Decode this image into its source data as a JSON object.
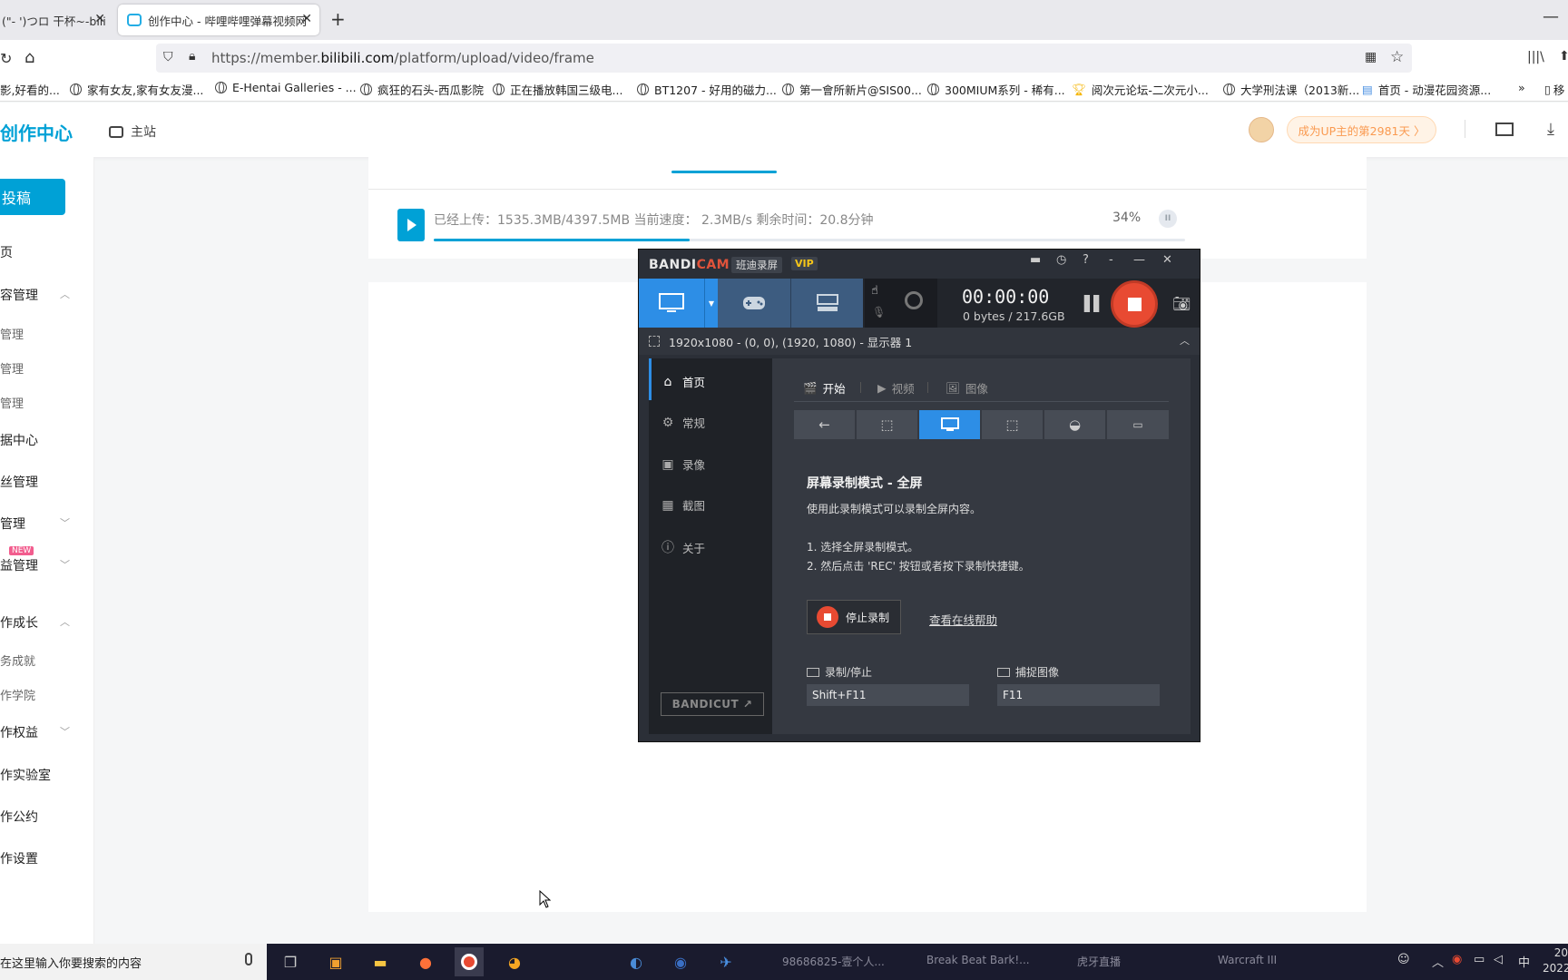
{
  "browser": {
    "tabs": [
      {
        "label": "(\"- ')つロ 干杯~-bili"
      },
      {
        "label": "创作中心 - 哔哩哔哩弹幕视频网"
      }
    ],
    "new_tab": "+",
    "url_prefix": "https://member.",
    "url_domain": "bilibili.com",
    "url_path": "/platform/upload/video/frame",
    "bookmarks": [
      "影,好看的...",
      "家有女友,家有女友漫...",
      "E-Hentai Galleries - ...",
      "疯狂的石头-西瓜影院",
      "正在播放韩国三级电...",
      "BT1207 - 好用的磁力...",
      "第一會所新片@SIS00...",
      "300MIUM系列 - 稀有...",
      "阅次元论坛-二次元小...",
      "大学刑法课（2013新...",
      "首页 - 动漫花园资源...",
      "移"
    ]
  },
  "site": {
    "logo": "创作中心",
    "home_link": "主站",
    "up_pill": "成为UP主的第2981天 〉"
  },
  "sidebar": {
    "upload": "投稿",
    "items": [
      {
        "label": "页",
        "sub": false
      },
      {
        "label": "容管理",
        "sub": false,
        "chev": "︿"
      },
      {
        "label": "管理",
        "sub": true
      },
      {
        "label": "管理",
        "sub": true
      },
      {
        "label": "管理",
        "sub": true
      },
      {
        "label": "据中心",
        "sub": false
      },
      {
        "label": "丝管理",
        "sub": false
      },
      {
        "label": "管理",
        "sub": false,
        "chev": "﹀"
      },
      {
        "label": "益管理",
        "sub": false,
        "chev": "﹀"
      },
      {
        "label": "作成长",
        "sub": false,
        "chev": "︿"
      },
      {
        "label": "务成就",
        "sub": true
      },
      {
        "label": "作学院",
        "sub": true
      },
      {
        "label": "作权益",
        "sub": false,
        "chev": "﹀"
      },
      {
        "label": "作实验室",
        "sub": false
      },
      {
        "label": "作公约",
        "sub": false
      },
      {
        "label": "作设置",
        "sub": false
      }
    ],
    "new_badge": "NEW"
  },
  "upload": {
    "status": "已经上传：1535.3MB/4397.5MB  当前速度：  2.3MB/s  剩余时间：20.8分钟",
    "percent_label": "34%",
    "progress": 0.34,
    "pause": "II"
  },
  "bandicam": {
    "brand_a": "BANDI",
    "brand_b": "CAM",
    "subtitle": "班迪录屏",
    "vip": "VIP",
    "timer": "00:00:00",
    "bytes": "0 bytes / 217.6GB",
    "region": "1920x1080 - (0, 0), (1920, 1080) - 显示器 1",
    "nav": [
      {
        "icon": "⌂",
        "label": "首页"
      },
      {
        "icon": "⚙",
        "label": "常规"
      },
      {
        "icon": "▣",
        "label": "录像"
      },
      {
        "icon": "▦",
        "label": "截图"
      },
      {
        "icon": "ⓘ",
        "label": "关于"
      }
    ],
    "content_tabs": [
      {
        "icon": "🎬",
        "label": "开始"
      },
      {
        "icon": "▶",
        "label": "视频"
      },
      {
        "icon": "🖼",
        "label": "图像"
      }
    ],
    "mode_title": "屏幕录制模式 - 全屏",
    "mode_desc": "使用此录制模式可以录制全屏内容。",
    "step1": "1. 选择全屏录制模式。",
    "step2": "2. 然后点击 'REC' 按钮或者按下录制快捷键。",
    "stop_label": "停止录制",
    "help_link": "查看在线帮助",
    "hotkey_rec_label": "录制/停止",
    "hotkey_rec_value": "Shift+F11",
    "hotkey_cap_label": "捕捉图像",
    "hotkey_cap_value": "F11",
    "bandicut": "BANDICUT ↗"
  },
  "taskbar": {
    "search": "在这里输入你要搜索的内容",
    "apps": [
      "98686825-壹个人...",
      "Break Beat Bark!...",
      "虎牙直播",
      "Warcraft III"
    ],
    "ime": "中",
    "time": "20",
    "date": "2022"
  }
}
